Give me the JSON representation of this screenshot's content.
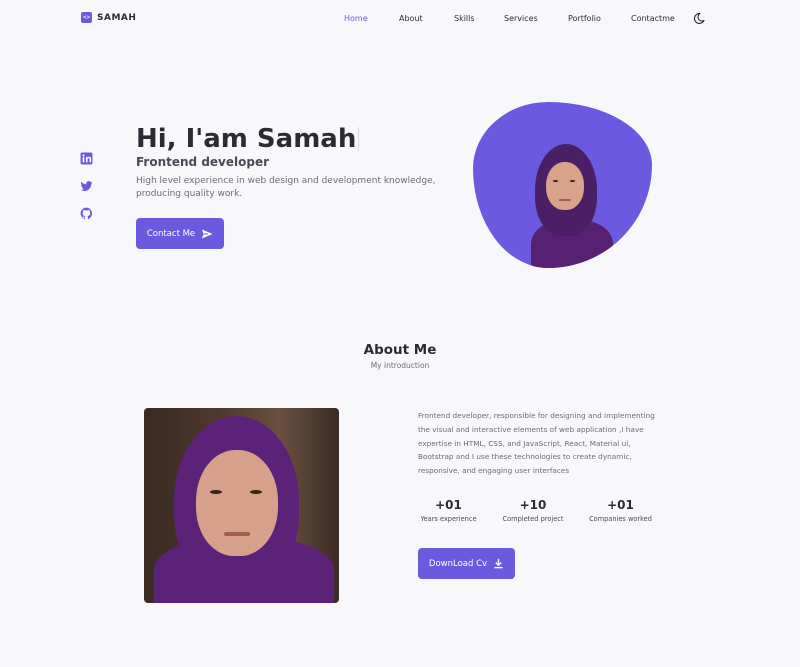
{
  "header": {
    "logo_text": "SAMAH",
    "logo_icon": "code-icon",
    "nav": [
      "Home",
      "About",
      "Skills",
      "Services",
      "Portfolio",
      "Contactme"
    ],
    "active_nav": "Home",
    "theme_icon": "moon-icon"
  },
  "social": [
    "linkedin-icon",
    "twitter-icon",
    "github-icon"
  ],
  "hero": {
    "title": "Hi, I'am Samah",
    "subtitle": "Frontend developer",
    "description": "High level experience in web design and development knowledge, producing quality work.",
    "button_label": "Contact Me",
    "button_icon": "send-icon"
  },
  "about": {
    "title": "About Me",
    "subtitle": "My introduction",
    "description": "Frontend developer, responsible for designing and implementing the visual and interactive elements of web application ,I have expertise in HTML, CSS, and JavaScript, React, Material ui, Bootstrap and I use these technologies to create dynamic, responsive, and engaging user interfaces",
    "stats": [
      {
        "number": "+01",
        "label": "Years experience"
      },
      {
        "number": "+10",
        "label": "Completed project"
      },
      {
        "number": "+01",
        "label": "Companies worked"
      }
    ],
    "button_label": "DownLoad Cv",
    "button_icon": "download-icon"
  },
  "colors": {
    "accent": "#6b5ae0",
    "background": "#f8f8fb",
    "text": "#2b2b33"
  }
}
